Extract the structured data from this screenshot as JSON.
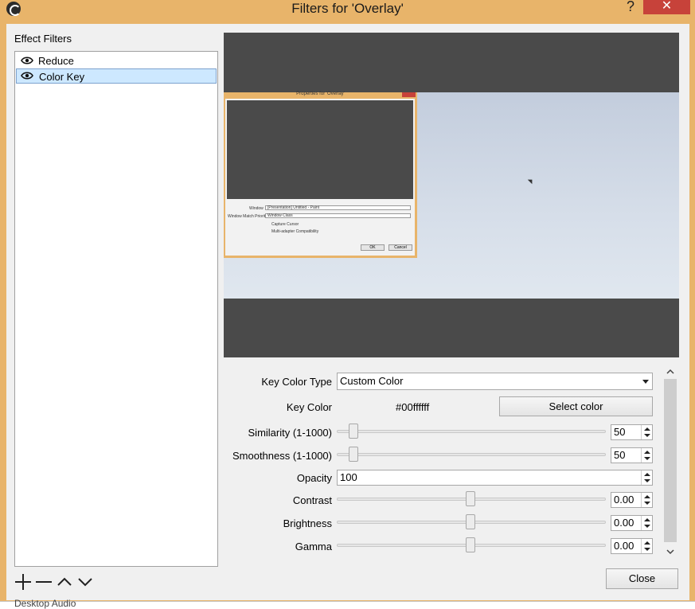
{
  "window": {
    "title": "Filters for 'Overlay'",
    "help_label": "?",
    "close_glyph": "✕",
    "frame_color": "#e8b46a",
    "close_color": "#c7423a"
  },
  "filters": {
    "section_label": "Effect Filters",
    "items": [
      {
        "label": "Reduce",
        "visible": true,
        "selected": false
      },
      {
        "label": "Color Key",
        "visible": true,
        "selected": true
      }
    ],
    "selection_color": "#cde8ff"
  },
  "toolbar": {
    "add_icon": "plus-icon",
    "remove_icon": "minus-icon",
    "up_icon": "chevron-up-icon",
    "down_icon": "chevron-down-icon"
  },
  "preview": {
    "background": "#4a4a4a",
    "nested_window_title": "Properties for 'Overlay'",
    "nested_window_label": "Window",
    "nested_window_value": "[Presentation] Untitled - Paint",
    "nested_priority_label": "Window Match Priority",
    "nested_priority_value": "Window Class",
    "nested_capture_cursor": "Capture Cursor",
    "nested_multiadapter": "Multi-adapter Compatibility",
    "nested_ok": "OK",
    "nested_cancel": "Cancel"
  },
  "properties": {
    "key_color_type": {
      "label": "Key Color Type",
      "value": "Custom Color"
    },
    "key_color": {
      "label": "Key Color",
      "value": "#00ffffff",
      "button": "Select color"
    },
    "similarity": {
      "label": "Similarity (1-1000)",
      "value": "50",
      "fraction": 0.05
    },
    "smoothness": {
      "label": "Smoothness (1-1000)",
      "value": "50",
      "fraction": 0.05
    },
    "opacity": {
      "label": "Opacity",
      "value": "100"
    },
    "contrast": {
      "label": "Contrast",
      "value": "0.00",
      "fraction": 0.5
    },
    "brightness": {
      "label": "Brightness",
      "value": "0.00",
      "fraction": 0.5
    },
    "gamma": {
      "label": "Gamma",
      "value": "0.00",
      "fraction": 0.5
    }
  },
  "footer": {
    "close_label": "Close"
  },
  "background_text": "Desktop Audio"
}
